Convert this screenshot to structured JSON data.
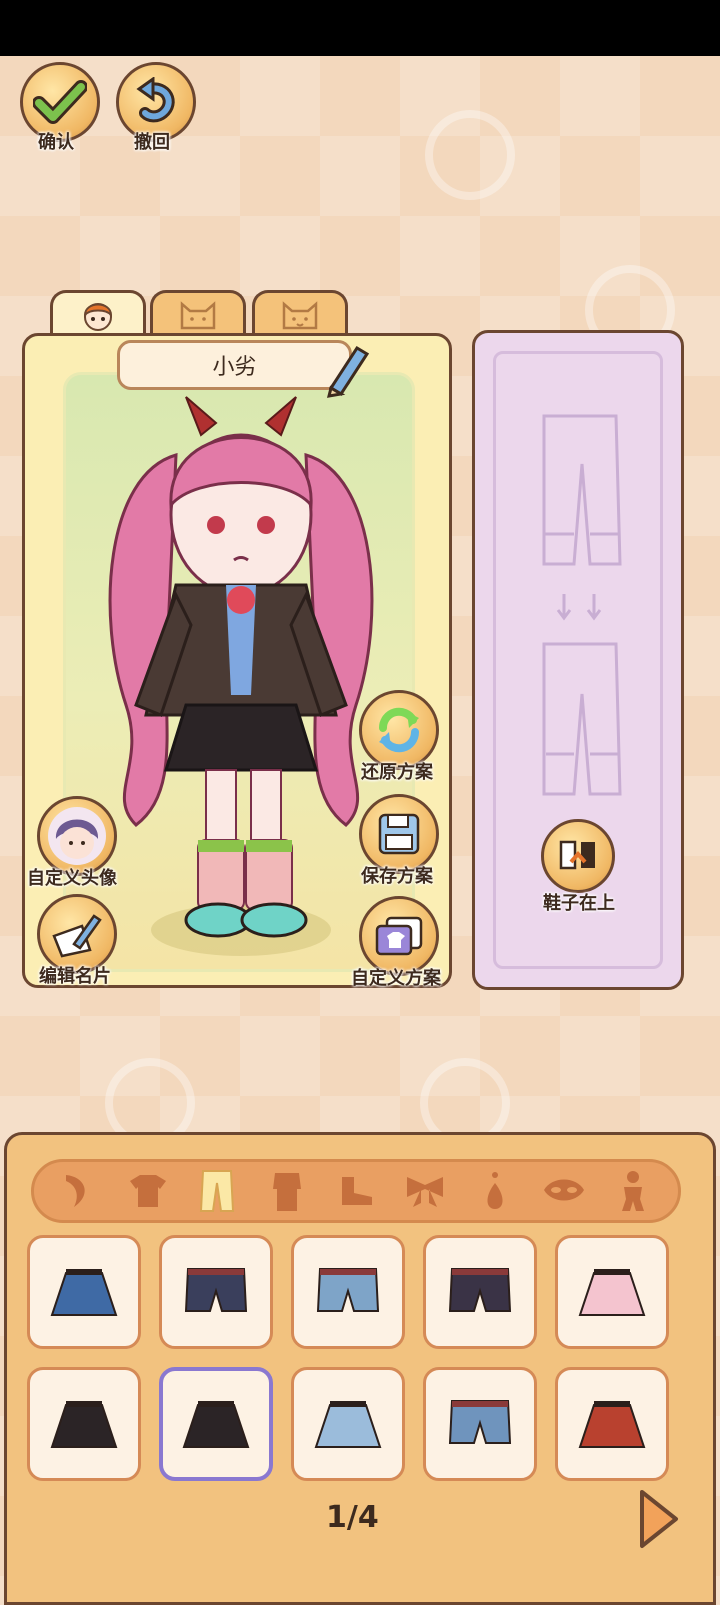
{
  "top_buttons": {
    "confirm": "确认",
    "undo": "撤回"
  },
  "tabs": [
    "face-tab",
    "cat-tab-1",
    "cat-tab-2"
  ],
  "character": {
    "name": "小劣"
  },
  "left_buttons": {
    "custom_avatar": "自定义头像",
    "edit_card": "编辑名片"
  },
  "right_buttons": {
    "restore": "还原方案",
    "save": "保存方案",
    "custom": "自定义方案"
  },
  "side_panel": {
    "shoes_on_top": "鞋子在上"
  },
  "categories": [
    "hair-icon",
    "top-icon",
    "pants-icon",
    "outfit-icon",
    "shoes-icon",
    "bow-icon",
    "earring-icon",
    "mask-icon",
    "pose-icon"
  ],
  "active_category": "pants-icon",
  "items": [
    {
      "id": "skirt-patterned",
      "color": "#3f6aa5"
    },
    {
      "id": "shorts-navy",
      "color": "#3a3f5c"
    },
    {
      "id": "shorts-denim",
      "color": "#7ea4c8"
    },
    {
      "id": "shorts-dark",
      "color": "#3a3346"
    },
    {
      "id": "skirt-pink",
      "color": "#f4c4cf"
    },
    {
      "id": "skirt-black-asym",
      "color": "#2b2426"
    },
    {
      "id": "skirt-black-pleated",
      "color": "#2b2426"
    },
    {
      "id": "skirt-blue-layered",
      "color": "#9bbcdb"
    },
    {
      "id": "shorts-light-denim",
      "color": "#6f94bd"
    },
    {
      "id": "skirt-red",
      "color": "#b9412f"
    }
  ],
  "selected_item": 6,
  "pagination": {
    "label": "1/4"
  }
}
